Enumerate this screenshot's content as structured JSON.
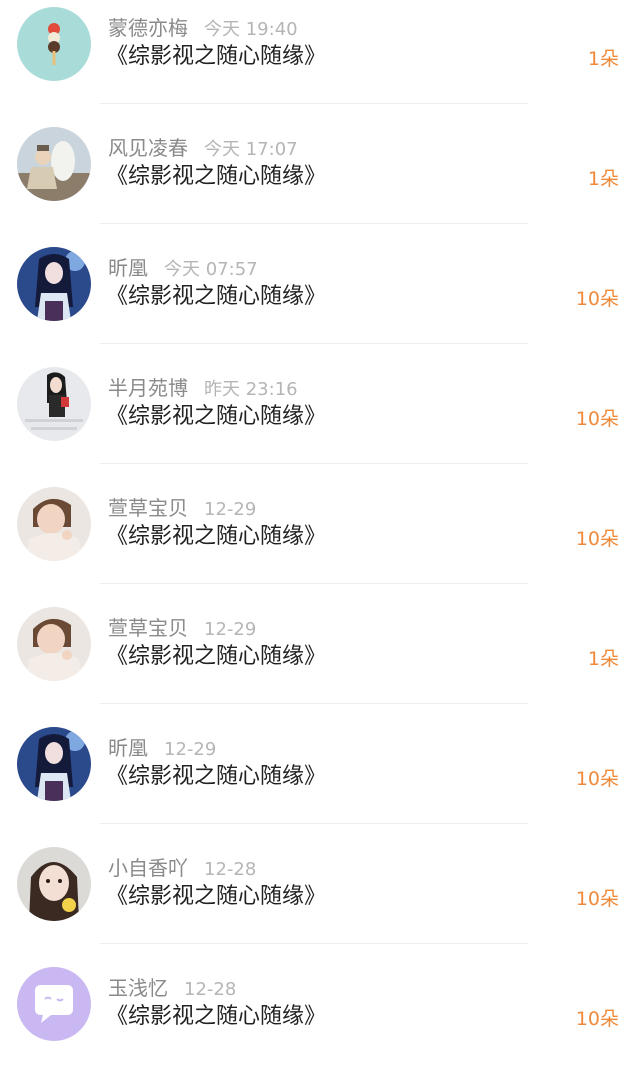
{
  "gift_list": {
    "items": [
      {
        "user": "蒙德亦梅",
        "time": "今天 19:40",
        "book": "《综影视之随心随缘》",
        "gift": "1朵",
        "avatar_icon": "ice-cream-avatar"
      },
      {
        "user": "风见凌春",
        "time": "今天 17:07",
        "book": "《综影视之随心随缘》",
        "gift": "1朵",
        "avatar_icon": "warrior-horse-avatar"
      },
      {
        "user": "昕凰",
        "time": "今天 07:57",
        "book": "《综影视之随心随缘》",
        "gift": "10朵",
        "avatar_icon": "anime-girl-avatar"
      },
      {
        "user": "半月苑博",
        "time": "昨天 23:16",
        "book": "《综影视之随心随缘》",
        "gift": "10朵",
        "avatar_icon": "girl-photo-avatar"
      },
      {
        "user": "萱草宝贝",
        "time": "12-29",
        "book": "《综影视之随心随缘》",
        "gift": "10朵",
        "avatar_icon": "child-photo-avatar"
      },
      {
        "user": "萱草宝贝",
        "time": "12-29",
        "book": "《综影视之随心随缘》",
        "gift": "1朵",
        "avatar_icon": "child-photo-avatar"
      },
      {
        "user": "昕凰",
        "time": "12-29",
        "book": "《综影视之随心随缘》",
        "gift": "10朵",
        "avatar_icon": "anime-girl-avatar"
      },
      {
        "user": "小自香吖",
        "time": "12-28",
        "book": "《综影视之随心随缘》",
        "gift": "10朵",
        "avatar_icon": "girl-portrait-avatar"
      },
      {
        "user": "玉浅忆",
        "time": "12-28",
        "book": "《综影视之随心随缘》",
        "gift": "10朵",
        "avatar_icon": "chat-bubble-avatar"
      }
    ]
  },
  "colors": {
    "gift_accent": "#ef8a3c",
    "username": "#8a8a8a",
    "timestamp": "#b5b5b5",
    "book_title": "#222222",
    "divider": "#eeeeee"
  }
}
